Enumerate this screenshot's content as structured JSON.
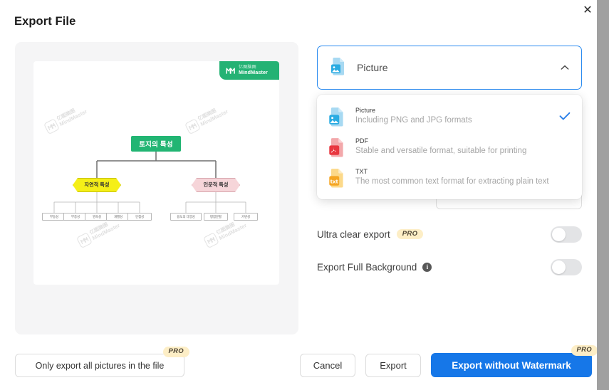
{
  "dialog": {
    "title": "Export File",
    "close_icon": "close-icon"
  },
  "preview": {
    "logo": {
      "cn": "亿图脑图",
      "en": "MindMaster",
      "icon": "mindmaster-logo-icon"
    },
    "watermark": {
      "cn": "亿图脑图",
      "en": "MindMaster"
    },
    "mindmap": {
      "root": "토지의 특성",
      "branches": [
        {
          "label": "자연적 특성",
          "color": "#f5ef18",
          "leaves": [
            "부동성",
            "부증성",
            "영속성",
            "개별성",
            "인접성"
          ]
        },
        {
          "label": "인문적 특성",
          "color": "#f6d5d9",
          "leaves": [
            "용도의 다양성",
            "병합분할",
            "가변성"
          ]
        }
      ]
    }
  },
  "format_select": {
    "selected_label": "Picture",
    "icon": "picture-file-icon",
    "caret_icon": "chevron-up-icon",
    "options": [
      {
        "title": "Picture",
        "desc": "Including PNG and JPG formats",
        "icon": "picture-file-icon",
        "selected": true,
        "check_icon": "check-icon"
      },
      {
        "title": "PDF",
        "desc": "Stable and versatile format, suitable for printing",
        "icon": "pdf-file-icon",
        "selected": false,
        "check_icon": ""
      },
      {
        "title": "TXT",
        "desc": "The most common text format for extracting plain text",
        "icon": "txt-file-icon",
        "selected": false,
        "check_icon": ""
      }
    ]
  },
  "settings": [
    {
      "label": "Ultra clear export",
      "badge": "PRO",
      "has_info": false,
      "enabled": false
    },
    {
      "label": "Export Full Background",
      "badge": "",
      "has_info": true,
      "info_icon": "info-icon",
      "enabled": false
    }
  ],
  "footer": {
    "only_export_label": "Only export all pictures in the file",
    "only_export_badge": "PRO",
    "cancel_label": "Cancel",
    "export_label": "Export",
    "export_nowm_label": "Export without Watermark",
    "export_nowm_badge": "PRO"
  },
  "colors": {
    "accent_blue": "#1677e8",
    "select_border": "#2a8bf0",
    "brand_green": "#24b274",
    "pro_badge_bg": "#fdeec6"
  }
}
